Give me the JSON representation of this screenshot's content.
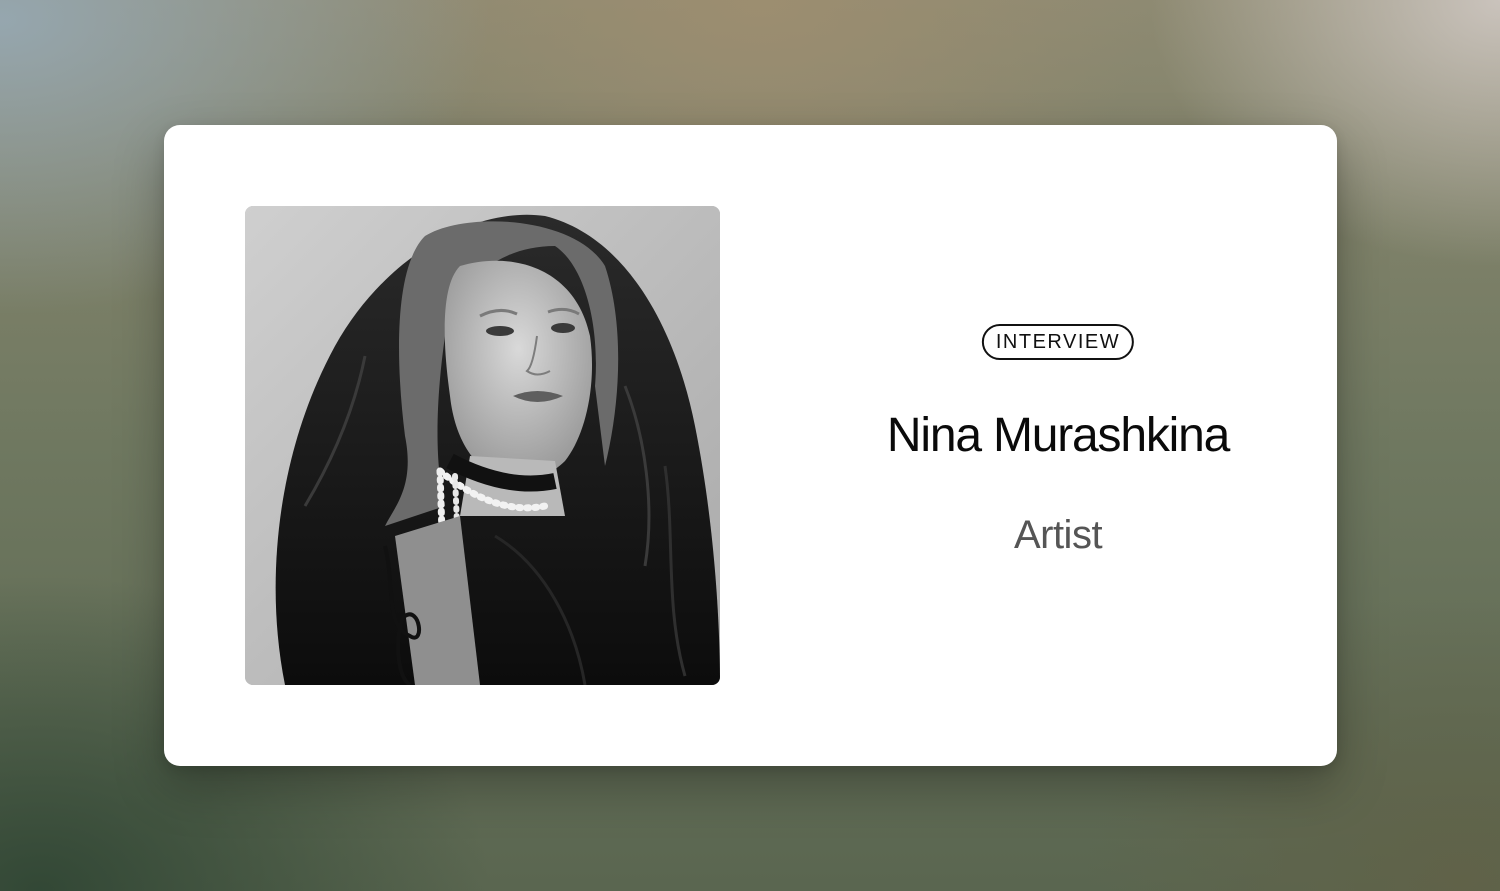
{
  "card": {
    "badge": "INTERVIEW",
    "name": "Nina Murashkina",
    "role": "Artist"
  },
  "portrait": {
    "alt": "Black and white portrait of Nina Murashkina"
  }
}
